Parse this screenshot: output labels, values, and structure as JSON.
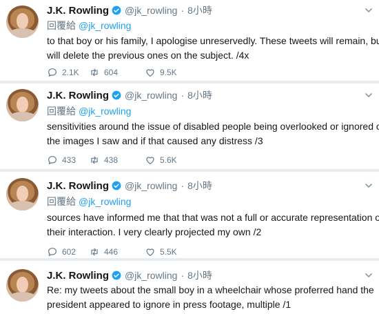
{
  "tweets": [
    {
      "author_name": "J.K. Rowling",
      "author_handle": "@jk_rowling",
      "separator": "·",
      "time": "8小時",
      "replying_label": "回覆給",
      "replying_handle": "@jk_rowling",
      "text_lines": [
        "to that boy or his family, I apologise unreservedly. These tweets will remain, but I",
        "will delete the previous ones on the subject. /4x"
      ],
      "replies": "2.1K",
      "retweets": "604",
      "likes": "9.5K"
    },
    {
      "author_name": "J.K. Rowling",
      "author_handle": "@jk_rowling",
      "separator": "·",
      "time": "8小時",
      "replying_label": "回覆給",
      "replying_handle": "@jk_rowling",
      "text_lines": [
        "sensitivities around the issue of disabled people being overlooked or ignored onto",
        "the images I saw and if that caused any distress /3"
      ],
      "replies": "433",
      "retweets": "438",
      "likes": "5.6K"
    },
    {
      "author_name": "J.K. Rowling",
      "author_handle": "@jk_rowling",
      "separator": "·",
      "time": "8小時",
      "replying_label": "回覆給",
      "replying_handle": "@jk_rowling",
      "text_lines": [
        "sources have informed me that that was not a full or accurate representation of",
        "their interaction. I very clearly projected my own /2"
      ],
      "replies": "602",
      "retweets": "446",
      "likes": "5.5K"
    },
    {
      "author_name": "J.K. Rowling",
      "author_handle": "@jk_rowling",
      "separator": "·",
      "time": "8小時",
      "text_lines": [
        "Re: my tweets about the small boy in a wheelchair whose proferred hand the",
        "president appeared to ignore in press footage, multiple /1"
      ]
    }
  ],
  "colors": {
    "accent": "#1da1f2",
    "secondary_text": "#657786",
    "primary_text": "#14171a",
    "divider": "#e6ecf0"
  },
  "icons": {
    "verified": "verified-badge-icon",
    "chevron": "chevron-down-icon",
    "reply": "reply-icon",
    "retweet": "retweet-icon",
    "like": "heart-icon"
  }
}
